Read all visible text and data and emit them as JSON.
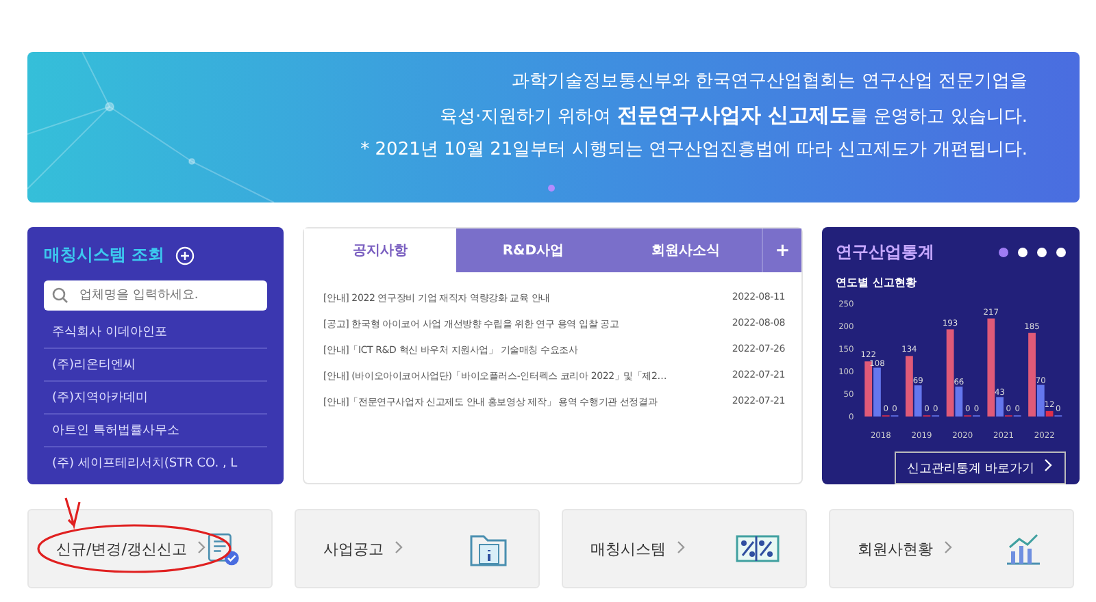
{
  "banner": {
    "lines": [
      "과학기술정보통신부와 한국연구산업협회는 연구산업 전문기업을",
      "육성·지원하기 위하여 **전문연구사업자 신고제도**를 운영하고 있습니다.",
      "* 2021년 10월 21일부터 시행되는 연구산업진흥법에 따라 신고제도가 개편됩니다."
    ],
    "pager": [
      {
        "selected": true
      }
    ]
  },
  "matching": {
    "title": "매칭시스템 조회",
    "search": {
      "placeholder": "업체명을 입력하세요."
    },
    "companies": [
      "주식회사 이데아인포",
      "(주)리온티엔씨",
      "(주)지역아카데미",
      "아트인 특허법률사무소",
      "(주) 세이프테리서치(STR CO. , L"
    ]
  },
  "news": {
    "tabs": [
      {
        "label": "공지사항",
        "selected": true
      },
      {
        "label": "R&D사업",
        "selected": false
      },
      {
        "label": "회원사소식",
        "selected": false
      }
    ],
    "more": "+",
    "items": [
      {
        "title": "[안내] 2022 연구장비 기업 재직자 역량강화 교육 안내",
        "date": "2022-08-11"
      },
      {
        "title": "[공고] 한국형 아이코어 사업 개선방향 수립을 위한 연구 용역 입찰 공고",
        "date": "2022-08-08"
      },
      {
        "title": "[안내]「ICT R&D 혁신 바우처 지원사업」 기술매칭 수요조사",
        "date": "2022-07-26"
      },
      {
        "title": "[안내] (바이오아이코어사업단)「바이오플러스-인터펙스 코리아 2022」및「제2…",
        "date": "2022-07-21"
      },
      {
        "title": "[안내]「전문연구사업자 신고제도 안내 홍보영상 제작」 용역 수행기관 선정결과",
        "date": "2022-07-21"
      }
    ]
  },
  "stats": {
    "title": "연구산업통계",
    "pager": [
      {
        "selected": true
      },
      {
        "selected": false
      },
      {
        "selected": false
      },
      {
        "selected": false
      }
    ],
    "subtitle": "연도별 신고현황",
    "chart_data": {
      "type": "bar",
      "categories": [
        "2018",
        "2019",
        "2020",
        "2021",
        "2022"
      ],
      "ylim": [
        0,
        250
      ],
      "yticks": [
        0,
        50,
        100,
        150,
        200,
        250
      ],
      "data_labels": true,
      "series": [
        {
          "color": "#e05a78",
          "values": [
            122,
            134,
            193,
            217,
            185
          ]
        },
        {
          "color": "#6577ee",
          "values": [
            108,
            69,
            66,
            43,
            70
          ]
        },
        {
          "color": "#e0304a",
          "values": [
            0,
            0,
            0,
            0,
            12
          ]
        },
        {
          "color": "#6577ee",
          "values": [
            0,
            0,
            0,
            0,
            0
          ]
        }
      ]
    },
    "link": "신고관리통계 바로가기"
  },
  "tiles": [
    {
      "label": "신규/변경/갱신신고",
      "kind": "report",
      "circled": true
    },
    {
      "label": "사업공고",
      "kind": "folder",
      "circled": false
    },
    {
      "label": "매칭시스템",
      "kind": "puzzle",
      "circled": false
    },
    {
      "label": "회원사현황",
      "kind": "chart",
      "circled": false
    }
  ]
}
